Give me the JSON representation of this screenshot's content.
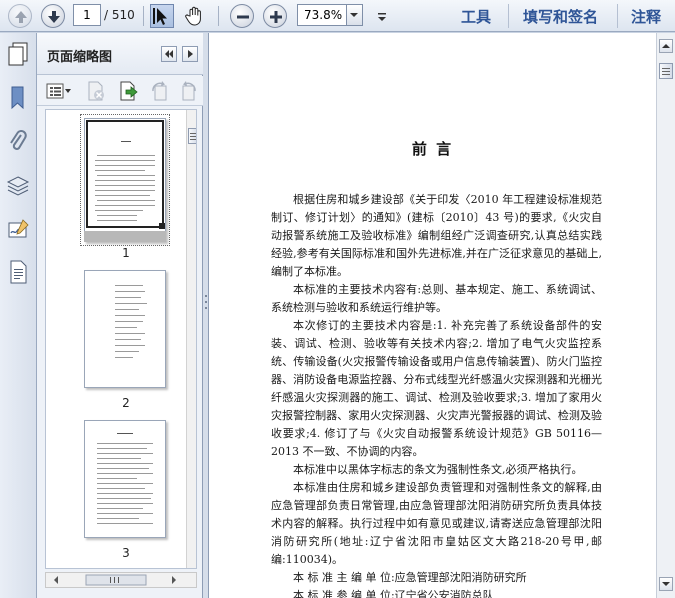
{
  "toolbar": {
    "current_page": "1",
    "page_total": "/ 510",
    "zoom_value": "73.8%",
    "menus": [
      "工具",
      "填写和签名",
      "注释"
    ]
  },
  "panel": {
    "title": "页面缩略图",
    "thumbnails": [
      {
        "number": "1"
      },
      {
        "number": "2"
      },
      {
        "number": "3"
      }
    ]
  },
  "document": {
    "heading": "前 言",
    "paragraphs": [
      {
        "text": "根据住房和城乡建设部《关于印发〈2010 年工程建设标准规范制订、修订计划〉的通知》(建标〔2010〕43 号)的要求,《火灾自动报警系统施工及验收标准》编制组经广泛调查研究,认真总结实践经验,参考有关国际标准和国外先进标准,并在广泛征求意见的基础上,编制了本标准。",
        "bold": false
      },
      {
        "text": "本标准的主要技术内容有:总则、基本规定、施工、系统调试、系统检测与验收和系统运行维护等。",
        "bold": false
      },
      {
        "text": "本次修订的主要技术内容是:1. 补充完善了系统设备部件的安装、调试、检测、验收等有关技术内容;2. 增加了电气火灾监控系统、传输设备(火灾报警传输设备或用户信息传输装置)、防火门监控器、消防设备电源监控器、分布式线型光纤感温火灾探测器和光栅光纤感温火灾探测器的施工、调试、检测及验收要求;3. 增加了家用火灾报警控制器、家用火灾探测器、火灾声光警报器的调试、检测及验收要求;4. 修订了与《火灾自动报警系统设计规范》GB 50116—2013 不一致、不协调的内容。",
        "bold": false
      },
      {
        "text": "本标准中以黑体字标志的条文为强制性条文,必须严格执行。",
        "bold": false
      },
      {
        "text": "本标准由住房和城乡建设部负责管理和对强制性条文的解释,由应急管理部负责日常管理,由应急管理部沈阳消防研究所负责具体技术内容的解释。执行过程中如有意见或建议,请寄送应急管理部沈阳消防研究所(地址:辽宁省沈阳市皇姑区文大路218-20号甲,邮编:110034)。",
        "bold": false
      },
      {
        "text": "本 标 准 主 编 单 位:应急管理部沈阳消防研究所",
        "bold": false
      },
      {
        "text": "本 标 准 参 编 单 位:辽宁省公安消防总队",
        "bold": false
      }
    ]
  },
  "colors": {
    "accent": "#2f5597",
    "toolbar_bg": "#dde5f0"
  }
}
